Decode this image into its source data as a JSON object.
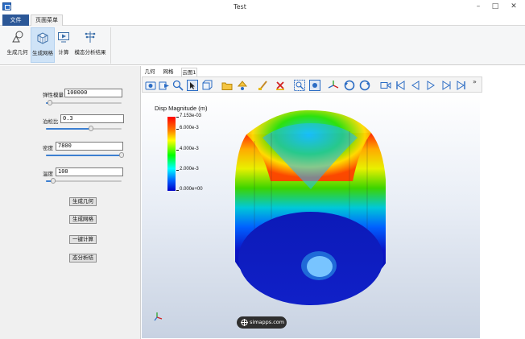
{
  "window": {
    "title": "Test",
    "minimize_glyph": "–",
    "maximize_glyph": "□",
    "close_glyph": "✕"
  },
  "ribbon_tabs": {
    "file": "文件",
    "home": "页面菜单"
  },
  "ribbon": {
    "buttons": [
      {
        "label": "生成几何",
        "icon": "geometry-icon"
      },
      {
        "label": "生成网格",
        "icon": "mesh-icon"
      },
      {
        "label": "计算",
        "icon": "compute-icon"
      },
      {
        "label": "模态分析结果",
        "icon": "modal-result-icon"
      }
    ]
  },
  "params": {
    "elastic_modulus": {
      "label": "弹性模量",
      "value": "100000",
      "slider": 0.05
    },
    "poisson_ratio": {
      "label": "泊松比",
      "value": "0.3",
      "slider": 0.6
    },
    "density": {
      "label": "密度",
      "value": "7800",
      "slider": 1.0
    },
    "temperature": {
      "label": "温度",
      "value": "100",
      "slider": 0.1
    }
  },
  "actions": {
    "gen_geometry": "生成几何",
    "gen_mesh": "生成网格",
    "compute": "一键计算",
    "modal_result": "态分析结"
  },
  "view_tabs": {
    "geometry": "几何",
    "mesh": "网格",
    "cloud": "云图1"
  },
  "toolbar": {
    "overflow": "»"
  },
  "plot": {
    "title": "Disp Magnitude (m)",
    "ticks": [
      "7.153e-03",
      "6.000e-3",
      "4.000e-3",
      "2.000e-3",
      "0.000e+00"
    ],
    "range": [
      0,
      0.007153
    ]
  },
  "watermark": "simapps.com",
  "colors": {
    "accent": "#2b5797",
    "active_ribbon": "#cfe3f7",
    "toolbar_icon": "#2b6cc4"
  }
}
